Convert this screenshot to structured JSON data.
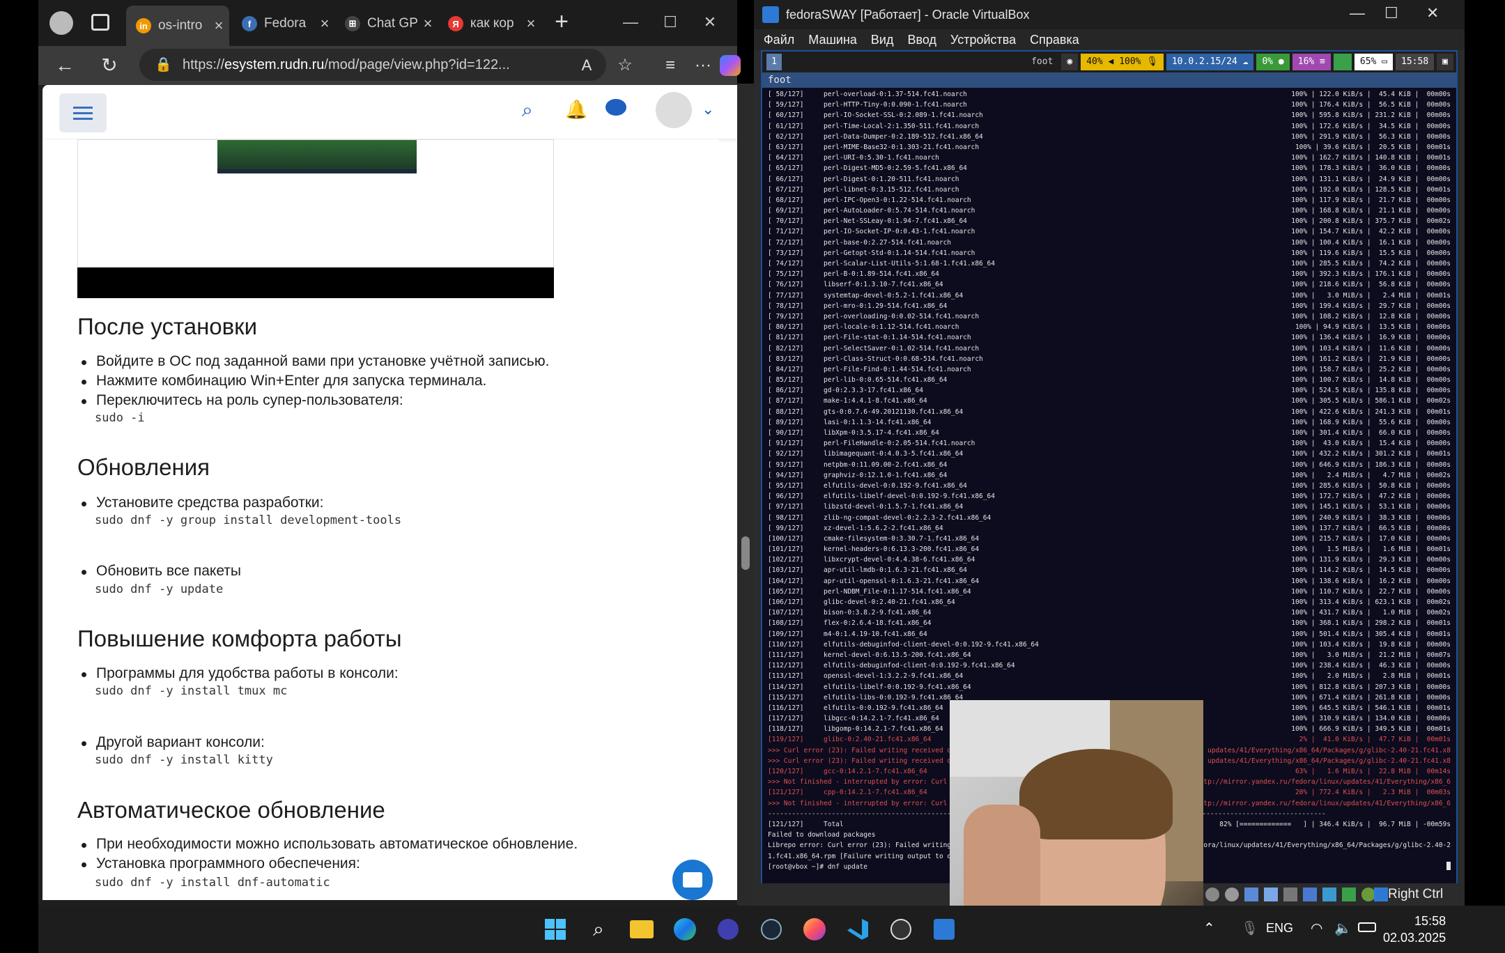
{
  "browser": {
    "tabs": [
      {
        "label": "os-intro",
        "favicon_color": "#f29900",
        "favicon": "in"
      },
      {
        "label": "Fedora",
        "favicon_color": "#3c6eb4",
        "favicon": "f"
      },
      {
        "label": "Chat GP",
        "favicon_color": "#444444",
        "favicon": "⊞"
      },
      {
        "label": "как кор",
        "favicon_color": "#e53935",
        "favicon": "Я"
      }
    ],
    "url_prefix": "https://",
    "url_host": "esystem.rudn.ru",
    "url_path": "/mod/page/view.php?id=122...",
    "new_tab": "+"
  },
  "moodle": {
    "sections": [
      {
        "title": "После установки",
        "items": [
          "Войдите в ОС под заданной вами при установке учётной записью.",
          "Нажмите комбинацию Win+Enter для запуска терминала.",
          "Переключитесь на роль супер-пользователя:"
        ],
        "code": "sudo -i"
      },
      {
        "title": "Обновления",
        "items": [
          "Установите средства разработки:"
        ],
        "code": "sudo dnf -y group install development-tools",
        "items2": [
          "Обновить все пакеты"
        ],
        "code2": "sudo dnf -y update"
      },
      {
        "title": "Повышение комфорта работы",
        "items": [
          "Программы для удобства работы в консоли:"
        ],
        "code": "sudo dnf -y install tmux mc",
        "items2": [
          "Другой вариант консоли:"
        ],
        "code2": "sudo dnf -y install kitty"
      },
      {
        "title": "Автоматическое обновление",
        "items": [
          "При необходимости можно использовать автоматическое обновление.",
          "Установка программного обеспечения:"
        ],
        "code": "sudo dnf -y install dnf-automatic"
      }
    ]
  },
  "vbox": {
    "title": "fedoraSWAY [Работает] - Oracle VirtualBox",
    "menu": [
      "Файл",
      "Машина",
      "Вид",
      "Ввод",
      "Устройства",
      "Справка"
    ],
    "host_key": "Right Ctrl",
    "sway": {
      "workspace": "1",
      "app": "foot",
      "volume": "40%",
      "mic": "100%",
      "ip": "10.0.2.15/24",
      "cpu": "0%",
      "mem": "16%",
      "disk": "65%",
      "time": "15:58"
    },
    "window_title": "foot",
    "terminal": [
      {
        "n": "[ 58/127]",
        "p": "perl-overload-0:1.37-514.fc41.noarch",
        "r": "100% | 122.0 KiB/s |  45.4 KiB |  00m00s"
      },
      {
        "n": "[ 59/127]",
        "p": "perl-HTTP-Tiny-0:0.090-1.fc41.noarch",
        "r": "100% | 176.4 KiB/s |  56.5 KiB |  00m00s"
      },
      {
        "n": "[ 60/127]",
        "p": "perl-IO-Socket-SSL-0:2.089-1.fc41.noarch",
        "r": "100% | 595.8 KiB/s | 231.2 KiB |  00m00s"
      },
      {
        "n": "[ 61/127]",
        "p": "perl-Time-Local-2:1.350-511.fc41.noarch",
        "r": "100% | 172.6 KiB/s |  34.5 KiB |  00m00s"
      },
      {
        "n": "[ 62/127]",
        "p": "perl-Data-Dumper-0:2.189-512.fc41.x86_64",
        "r": "100% | 291.9 KiB/s |  56.3 KiB |  00m00s"
      },
      {
        "n": "[ 63/127]",
        "p": "perl-MIME-Base32-0:1.303-21.fc41.noarch",
        "r": "100% | 39.6 KiB/s |  20.5 KiB |  00m01s"
      },
      {
        "n": "[ 64/127]",
        "p": "perl-URI-0:5.30-1.fc41.noarch",
        "r": "100% | 162.7 KiB/s | 140.8 KiB |  00m01s"
      },
      {
        "n": "[ 65/127]",
        "p": "perl-Digest-MD5-0:2.59-5.fc41.x86_64",
        "r": "100% | 178.3 KiB/s |  36.0 KiB |  00m00s"
      },
      {
        "n": "[ 66/127]",
        "p": "perl-Digest-0:1.20-511.fc41.noarch",
        "r": "100% | 131.1 KiB/s |  24.9 KiB |  00m00s"
      },
      {
        "n": "[ 67/127]",
        "p": "perl-libnet-0:3.15-512.fc41.noarch",
        "r": "100% | 192.0 KiB/s | 128.5 KiB |  00m01s"
      },
      {
        "n": "[ 68/127]",
        "p": "perl-IPC-Open3-0:1.22-514.fc41.noarch",
        "r": "100% | 117.9 KiB/s |  21.7 KiB |  00m00s"
      },
      {
        "n": "[ 69/127]",
        "p": "perl-AutoLoader-0:5.74-514.fc41.noarch",
        "r": "100% | 168.8 KiB/s |  21.1 KiB |  00m00s"
      },
      {
        "n": "[ 70/127]",
        "p": "perl-Net-SSLeay-0:1.94-7.fc41.x86_64",
        "r": "100% | 200.8 KiB/s | 375.7 KiB |  00m02s"
      },
      {
        "n": "[ 71/127]",
        "p": "perl-IO-Socket-IP-0:0.43-1.fc41.noarch",
        "r": "100% | 154.7 KiB/s |  42.2 KiB |  00m00s"
      },
      {
        "n": "[ 72/127]",
        "p": "perl-base-0:2.27-514.fc41.noarch",
        "r": "100% | 100.4 KiB/s |  16.1 KiB |  00m00s"
      },
      {
        "n": "[ 73/127]",
        "p": "perl-Getopt-Std-0:1.14-514.fc41.noarch",
        "r": "100% | 119.6 KiB/s |  15.5 KiB |  00m00s"
      },
      {
        "n": "[ 74/127]",
        "p": "perl-Scalar-List-Utils-5:1.68-1.fc41.x86_64",
        "r": "100% | 285.5 KiB/s |  74.2 KiB |  00m00s"
      },
      {
        "n": "[ 75/127]",
        "p": "perl-B-0:1.89-514.fc41.x86_64",
        "r": "100% | 392.3 KiB/s | 176.1 KiB |  00m00s"
      },
      {
        "n": "[ 76/127]",
        "p": "libserf-0:1.3.10-7.fc41.x86_64",
        "r": "100% | 218.6 KiB/s |  56.8 KiB |  00m00s"
      },
      {
        "n": "[ 77/127]",
        "p": "systemtap-devel-0:5.2-1.fc41.x86_64",
        "r": "100% |   3.0 MiB/s |   2.4 MiB |  00m01s"
      },
      {
        "n": "[ 78/127]",
        "p": "perl-mro-0:1.29-514.fc41.x86_64",
        "r": "100% | 199.4 KiB/s |  29.7 KiB |  00m00s"
      },
      {
        "n": "[ 79/127]",
        "p": "perl-overloading-0:0.02-514.fc41.noarch",
        "r": "100% | 108.2 KiB/s |  12.8 KiB |  00m00s"
      },
      {
        "n": "[ 80/127]",
        "p": "perl-locale-0:1.12-514.fc41.noarch",
        "r": "100% | 94.9 KiB/s |  13.5 KiB |  00m00s"
      },
      {
        "n": "[ 81/127]",
        "p": "perl-File-stat-0:1.14-514.fc41.noarch",
        "r": "100% | 136.4 KiB/s |  16.9 KiB |  00m00s"
      },
      {
        "n": "[ 82/127]",
        "p": "perl-SelectSaver-0:1.02-514.fc41.noarch",
        "r": "100% | 103.4 KiB/s |  11.6 KiB |  00m00s"
      },
      {
        "n": "[ 83/127]",
        "p": "perl-Class-Struct-0:0.68-514.fc41.noarch",
        "r": "100% | 161.2 KiB/s |  21.9 KiB |  00m00s"
      },
      {
        "n": "[ 84/127]",
        "p": "perl-File-Find-0:1.44-514.fc41.noarch",
        "r": "100% | 158.7 KiB/s |  25.2 KiB |  00m00s"
      },
      {
        "n": "[ 85/127]",
        "p": "perl-lib-0:0.65-514.fc41.x86_64",
        "r": "100% | 100.7 KiB/s |  14.8 KiB |  00m00s"
      },
      {
        "n": "[ 86/127]",
        "p": "gd-0:2.3.3-17.fc41.x86_64",
        "r": "100% | 524.5 KiB/s | 135.8 KiB |  00m00s"
      },
      {
        "n": "[ 87/127]",
        "p": "make-1:4.4.1-8.fc41.x86_64",
        "r": "100% | 305.5 KiB/s | 586.1 KiB |  00m02s"
      },
      {
        "n": "[ 88/127]",
        "p": "gts-0:0.7.6-49.20121130.fc41.x86_64",
        "r": "100% | 422.6 KiB/s | 241.3 KiB |  00m01s"
      },
      {
        "n": "[ 89/127]",
        "p": "lasi-0:1.1.3-14.fc41.x86_64",
        "r": "100% | 168.9 KiB/s |  55.6 KiB |  00m00s"
      },
      {
        "n": "[ 90/127]",
        "p": "libXpm-0:3.5.17-4.fc41.x86_64",
        "r": "100% | 301.4 KiB/s |  66.0 KiB |  00m00s"
      },
      {
        "n": "[ 91/127]",
        "p": "perl-FileHandle-0:2.05-514.fc41.noarch",
        "r": "100% |  43.0 KiB/s |  15.4 KiB |  00m00s"
      },
      {
        "n": "[ 92/127]",
        "p": "libimagequant-0:4.0.3-5.fc41.x86_64",
        "r": "100% | 432.2 KiB/s | 301.2 KiB |  00m01s"
      },
      {
        "n": "[ 93/127]",
        "p": "netpbm-0:11.09.00-2.fc41.x86_64",
        "r": "100% | 646.9 KiB/s | 186.3 KiB |  00m00s"
      },
      {
        "n": "[ 94/127]",
        "p": "graphviz-0:12.1.0-1.fc41.x86_64",
        "r": "100% |   2.4 MiB/s |   4.7 MiB |  00m02s"
      },
      {
        "n": "[ 95/127]",
        "p": "elfutils-devel-0:0.192-9.fc41.x86_64",
        "r": "100% | 285.6 KiB/s |  50.8 KiB |  00m00s"
      },
      {
        "n": "[ 96/127]",
        "p": "elfutils-libelf-devel-0:0.192-9.fc41.x86_64",
        "r": "100% | 172.7 KiB/s |  47.2 KiB |  00m00s"
      },
      {
        "n": "[ 97/127]",
        "p": "libzstd-devel-0:1.5.7-1.fc41.x86_64",
        "r": "100% | 145.1 KiB/s |  53.1 KiB |  00m00s"
      },
      {
        "n": "[ 98/127]",
        "p": "zlib-ng-compat-devel-0:2.2.3-2.fc41.x86_64",
        "r": "100% | 240.9 KiB/s |  38.3 KiB |  00m00s"
      },
      {
        "n": "[ 99/127]",
        "p": "xz-devel-1:5.6.2-2.fc41.x86_64",
        "r": "100% | 137.7 KiB/s |  66.5 KiB |  00m00s"
      },
      {
        "n": "[100/127]",
        "p": "cmake-filesystem-0:3.30.7-1.fc41.x86_64",
        "r": "100% | 215.7 KiB/s |  17.0 KiB |  00m00s"
      },
      {
        "n": "[101/127]",
        "p": "kernel-headers-0:6.13.3-200.fc41.x86_64",
        "r": "100% |   1.5 MiB/s |   1.6 MiB |  00m01s"
      },
      {
        "n": "[102/127]",
        "p": "libxcrypt-devel-0:4.4.38-6.fc41.x86_64",
        "r": "100% | 131.9 KiB/s |  29.3 KiB |  00m00s"
      },
      {
        "n": "[103/127]",
        "p": "apr-util-lmdb-0:1.6.3-21.fc41.x86_64",
        "r": "100% | 114.2 KiB/s |  14.5 KiB |  00m00s"
      },
      {
        "n": "[104/127]",
        "p": "apr-util-openssl-0:1.6.3-21.fc41.x86_64",
        "r": "100% | 138.6 KiB/s |  16.2 KiB |  00m00s"
      },
      {
        "n": "[105/127]",
        "p": "perl-NDBM_File-0:1.17-514.fc41.x86_64",
        "r": "100% | 110.7 KiB/s |  22.7 KiB |  00m00s"
      },
      {
        "n": "[106/127]",
        "p": "glibc-devel-0:2.40-21.fc41.x86_64",
        "r": "100% | 313.4 KiB/s | 623.1 KiB |  00m02s"
      },
      {
        "n": "[107/127]",
        "p": "bison-0:3.8.2-9.fc41.x86_64",
        "r": "100% | 431.7 KiB/s |   1.0 MiB |  00m02s"
      },
      {
        "n": "[108/127]",
        "p": "flex-0:2.6.4-18.fc41.x86_64",
        "r": "100% | 368.1 KiB/s | 298.2 KiB |  00m01s"
      },
      {
        "n": "[109/127]",
        "p": "m4-0:1.4.19-10.fc41.x86_64",
        "r": "100% | 501.4 KiB/s | 305.4 KiB |  00m01s"
      },
      {
        "n": "[110/127]",
        "p": "elfutils-debuginfod-client-devel-0:0.192-9.fc41.x86_64",
        "r": "100% | 103.4 KiB/s |  19.8 KiB |  00m00s"
      },
      {
        "n": "[111/127]",
        "p": "kernel-devel-0:6.13.5-200.fc41.x86_64",
        "r": "100% |   3.0 MiB/s |  21.2 MiB |  00m07s"
      },
      {
        "n": "[112/127]",
        "p": "elfutils-debuginfod-client-0:0.192-9.fc41.x86_64",
        "r": "100% | 238.4 KiB/s |  46.3 KiB |  00m00s"
      },
      {
        "n": "[113/127]",
        "p": "openssl-devel-1:3.2.2-9.fc41.x86_64",
        "r": "100% |   2.0 MiB/s |   2.8 MiB |  00m01s"
      },
      {
        "n": "[114/127]",
        "p": "elfutils-libelf-0:0.192-9.fc41.x86_64",
        "r": "100% | 812.8 KiB/s | 207.3 KiB |  00m00s"
      },
      {
        "n": "[115/127]",
        "p": "elfutils-libs-0:0.192-9.fc41.x86_64",
        "r": "100% | 671.4 KiB/s | 261.8 KiB |  00m00s"
      },
      {
        "n": "[116/127]",
        "p": "elfutils-0:0.192-9.fc41.x86_64",
        "r": "100% | 645.5 KiB/s | 546.1 KiB |  00m01s"
      },
      {
        "n": "[117/127]",
        "p": "libgcc-0:14.2.1-7.fc41.x86_64",
        "r": "100% | 310.9 KiB/s | 134.0 KiB |  00m00s"
      },
      {
        "n": "[118/127]",
        "p": "libgomp-0:14.2.1-7.fc41.x86_64",
        "r": "100% | 666.9 KiB/s | 349.5 KiB |  00m01s"
      },
      {
        "n": "[119/127]",
        "p": "glibc-0:2.40-21.fc41.x86_64",
        "r": "2% |  41.0 KiB/s |  47.7 KiB |  00m01s",
        "err": true
      },
      {
        "n": ">>> Curl error (23): Failed writing received data",
        "p": "",
        "r": "updates/41/Everything/x86_64/Packages/g/glibc-2.40-21.fc41.x8",
        "err": true
      },
      {
        "n": ">>> Curl error (23): Failed writing received data",
        "p": "",
        "r": "updates/41/Everything/x86_64/Packages/g/glibc-2.40-21.fc41.x8",
        "err": true
      },
      {
        "n": "[120/127]",
        "p": "gcc-0:14.2.1-7.fc41.x86_64",
        "r": "63% |   1.6 MiB/s |  22.8 MiB |  00m14s",
        "err": true
      },
      {
        "n": ">>> Not finished - interrupted by error: Curl e",
        "p": "",
        "r": "http://mirror.yandex.ru/fedora/linux/updates/41/Everything/x86_6",
        "err": true
      },
      {
        "n": "[121/127]",
        "p": "cpp-0:14.2.1-7.fc41.x86_64",
        "r": "20% | 772.4 KiB/s |   2.3 MiB |  00m03s",
        "err": true
      },
      {
        "n": ">>> Not finished - interrupted by error: Curl e",
        "p": "",
        "r": "http://mirror.yandex.ru/fedora/linux/updates/41/Everything/x86_6",
        "err": true
      },
      {
        "n": "--------------------------------------------------------------------------------------------------------------------------------------------",
        "p": "",
        "r": "",
        "sep": true
      },
      {
        "n": "[121/127]",
        "p": "Total",
        "r": "82% [=============   ] | 346.4 KiB/s |  96.7 MiB | -00m59s"
      },
      {
        "n": "Failed to download packages",
        "p": "",
        "r": ""
      },
      {
        "n": "Librepo error: Curl error (23): Failed writing",
        "p": "",
        "r": "fedora/linux/updates/41/Everything/x86_64/Packages/g/glibc-2.40-2"
      },
      {
        "n": "1.fc41.x86_64.rpm [Failure writing output to de",
        "p": "",
        "r": ""
      },
      {
        "n": "[root@vbox ~]# dnf update",
        "p": "",
        "r": ""
      }
    ]
  },
  "taskbar": {
    "lang": "ENG",
    "time": "15:58",
    "date": "02.03.2025"
  }
}
